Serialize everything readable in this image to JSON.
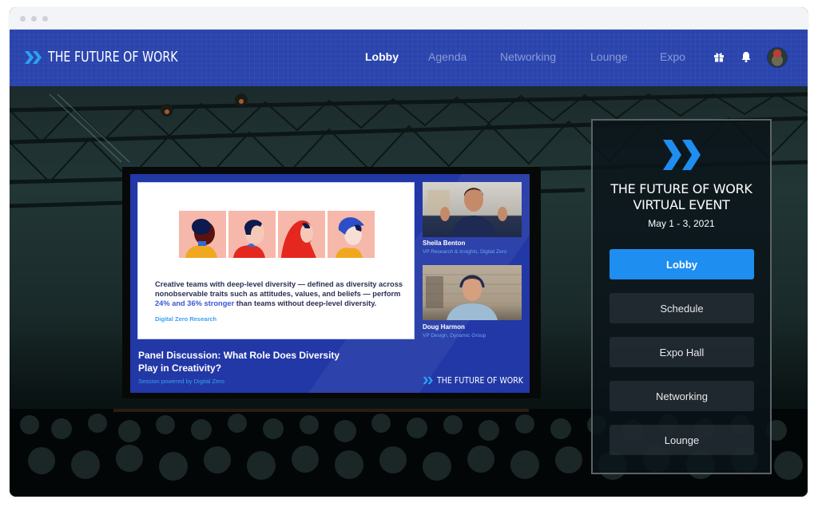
{
  "window": {
    "chrome_dots": 3
  },
  "header": {
    "brand": "THE FUTURE OF WORK",
    "nav": [
      {
        "label": "Lobby",
        "active": true
      },
      {
        "label": "Agenda",
        "active": false
      },
      {
        "label": "Networking",
        "active": false
      },
      {
        "label": "Lounge",
        "active": false
      },
      {
        "label": "Expo",
        "active": false
      }
    ],
    "icons": [
      "gift-icon",
      "bell-icon",
      "user-avatar"
    ]
  },
  "screen": {
    "slide": {
      "text_before": "Creative teams with deep-level diversity — defined as diversity across nonobservable traits such as attitudes, values, and beliefs — perform ",
      "highlight": "24% and 36% stronger",
      "text_after": " than teams without deep-level diversity.",
      "source": "Digital Zero Research"
    },
    "speakers": [
      {
        "name": "Sheila Benton",
        "title": "VP Research & Insights, Digital Zero"
      },
      {
        "name": "Doug Harmon",
        "title": "VP Design, Dynamic Group"
      }
    ],
    "session_title": "Panel Discussion: What Role Does Diversity Play in Creativity?",
    "session_sub": "Session powered by Digital Zero",
    "brand": "THE FUTURE OF WORK"
  },
  "panel": {
    "title_line1": "THE FUTURE OF WORK",
    "title_line2": "VIRTUAL EVENT",
    "date": "May 1 - 3, 2021",
    "buttons": [
      {
        "label": "Lobby",
        "active": true
      },
      {
        "label": "Schedule",
        "active": false
      },
      {
        "label": "Expo Hall",
        "active": false
      },
      {
        "label": "Networking",
        "active": false
      },
      {
        "label": "Lounge",
        "active": false
      }
    ]
  },
  "colors": {
    "nav_bg": "#2a44ad",
    "accent": "#1e8ef0",
    "screen_bg": "#2238a6"
  }
}
